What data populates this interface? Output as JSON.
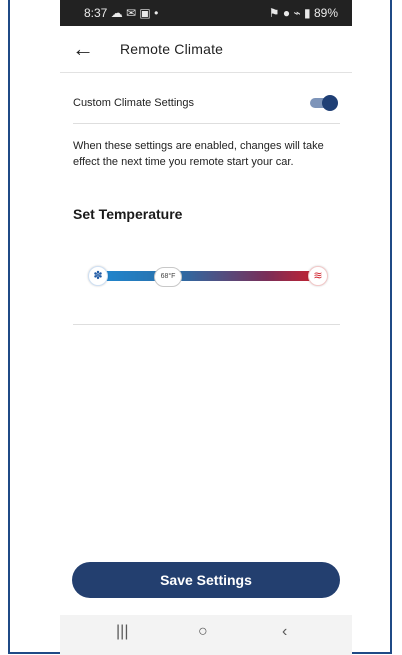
{
  "statusbar": {
    "time": "8:37",
    "left_icons": "☁ ✉ ▣ •",
    "right_icons": "⚑ ● ⌁ ▮",
    "battery": "89%"
  },
  "appbar": {
    "back_icon": "←",
    "title": "Remote Climate"
  },
  "custom": {
    "label": "Custom Climate Settings",
    "enabled": true
  },
  "description": "When these settings are enabled, changes will take effect the next time you remote start your car.",
  "temperature": {
    "heading": "Set Temperature",
    "value": "68°F",
    "cold_icon": "✽",
    "hot_icon": "≋"
  },
  "actions": {
    "save_label": "Save Settings"
  },
  "navbar": {
    "recent": "|||",
    "home": "○",
    "back": "‹"
  }
}
